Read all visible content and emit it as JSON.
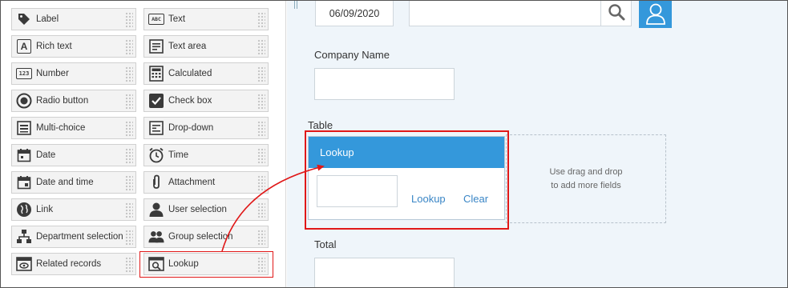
{
  "palette": {
    "left_column": [
      {
        "label": "Label",
        "icon": "tag-icon"
      },
      {
        "label": "Rich text",
        "icon": "rich-text-icon"
      },
      {
        "label": "Number",
        "icon": "number-icon"
      },
      {
        "label": "Radio button",
        "icon": "radio-icon"
      },
      {
        "label": "Multi-choice",
        "icon": "multi-choice-icon"
      },
      {
        "label": "Date",
        "icon": "calendar-icon"
      },
      {
        "label": "Date and time",
        "icon": "calendar-clock-icon"
      },
      {
        "label": "Link",
        "icon": "globe-icon"
      },
      {
        "label": "Department selection",
        "icon": "org-chart-icon"
      },
      {
        "label": "Related records",
        "icon": "related-records-icon"
      }
    ],
    "right_column": [
      {
        "label": "Text",
        "icon": "text-icon"
      },
      {
        "label": "Text area",
        "icon": "text-area-icon"
      },
      {
        "label": "Calculated",
        "icon": "calculator-icon"
      },
      {
        "label": "Check box",
        "icon": "checkbox-icon"
      },
      {
        "label": "Drop-down",
        "icon": "dropdown-icon"
      },
      {
        "label": "Time",
        "icon": "clock-icon"
      },
      {
        "label": "Attachment",
        "icon": "paperclip-icon"
      },
      {
        "label": "User selection",
        "icon": "user-icon"
      },
      {
        "label": "Group selection",
        "icon": "group-icon"
      },
      {
        "label": "Lookup",
        "icon": "lookup-icon"
      }
    ],
    "icon_text": {
      "abc": "ABC",
      "num": "123"
    }
  },
  "form": {
    "date_value": "06/09/2020",
    "search_value": "",
    "company_label": "Company Name",
    "company_value": "",
    "table_label": "Table",
    "lookup_title": "Lookup",
    "lookup_value": "",
    "lookup_link": "Lookup",
    "clear_link": "Clear",
    "dropzone_line1": "Use drag and drop",
    "dropzone_line2": "to add more fields",
    "total_label": "Total",
    "total_value": ""
  },
  "colors": {
    "accent": "#3498db",
    "highlight": "#e01818",
    "link": "#3a86c6",
    "form_bg": "#eff5fa"
  }
}
